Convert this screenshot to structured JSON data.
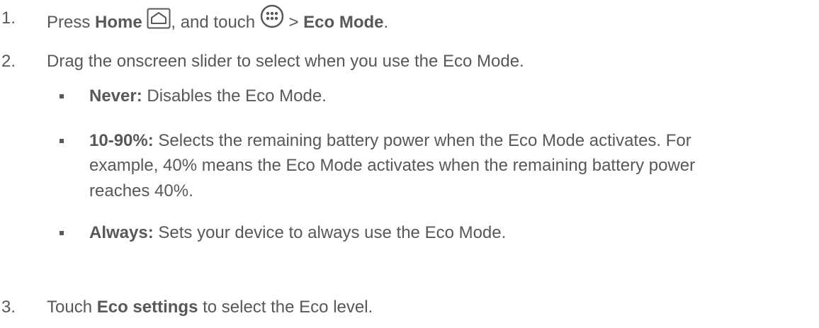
{
  "steps": [
    {
      "number": "1.",
      "pre": "Press ",
      "bold1": "Home",
      "mid": ", and touch ",
      "sep": " > ",
      "bold2": "Eco Mode",
      "end": ".",
      "icons": [
        "home-key-icon",
        "apps-grid-icon"
      ]
    },
    {
      "number": "2.",
      "text": "Drag the onscreen slider to select when you use the Eco Mode."
    },
    {
      "number": "3.",
      "pre": "Touch ",
      "bold": "Eco settings",
      "post": " to select the Eco level."
    }
  ],
  "options": [
    {
      "label": "Never:",
      "lines": [
        "Disables the Eco Mode."
      ]
    },
    {
      "label": "10-90%:",
      "lines": [
        "Selects the remaining battery power when the Eco Mode activates. For",
        "example, 40% means the Eco Mode activates when the remaining battery power",
        "reaches 40%."
      ]
    },
    {
      "label": "Always:",
      "lines": [
        "Sets your device to always use the Eco Mode."
      ]
    }
  ],
  "colors": {
    "text": "#58585a"
  }
}
